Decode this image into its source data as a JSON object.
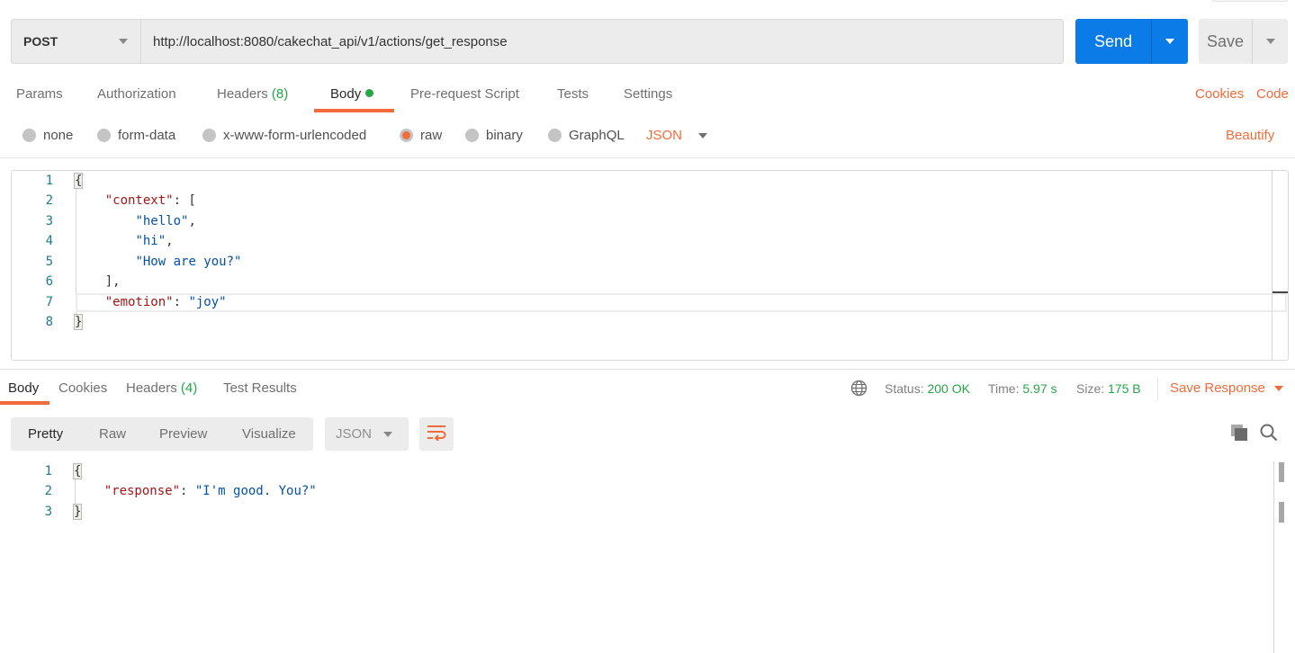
{
  "request": {
    "method": "POST",
    "url": "http://localhost:8080/cakechat_api/v1/actions/get_response",
    "send_label": "Send",
    "save_label": "Save"
  },
  "request_tabs": {
    "items": [
      {
        "label": "Params"
      },
      {
        "label": "Authorization"
      },
      {
        "label": "Headers",
        "count": "(8)"
      },
      {
        "label": "Body",
        "active": true,
        "indicator": "green-dot"
      },
      {
        "label": "Pre-request Script"
      },
      {
        "label": "Tests"
      },
      {
        "label": "Settings"
      }
    ],
    "cookies_link": "Cookies",
    "code_link": "Code"
  },
  "body_types": {
    "options": [
      "none",
      "form-data",
      "x-www-form-urlencoded",
      "raw",
      "binary",
      "GraphQL"
    ],
    "selected": "raw",
    "format": "JSON",
    "beautify_label": "Beautify"
  },
  "request_body": {
    "line_numbers": [
      "1",
      "2",
      "3",
      "4",
      "5",
      "6",
      "7",
      "8"
    ],
    "lines": [
      "{",
      "    \"context\": [",
      "        \"hello\",",
      "        \"hi\",",
      "        \"How are you?\"",
      "    ],",
      "    \"emotion\": \"joy\"",
      "}"
    ],
    "tokens": {
      "l1": "{",
      "l2_key": "\"context\"",
      "l2_rest": ": [",
      "l3": "\"hello\"",
      "l4": "\"hi\"",
      "l5": "\"How are you?\"",
      "l6": "],",
      "l7_key": "\"emotion\"",
      "l7_sep": ": ",
      "l7_val": "\"joy\"",
      "l8": "}",
      "comma": ","
    }
  },
  "response_tabs": {
    "items": [
      {
        "label": "Body",
        "active": true
      },
      {
        "label": "Cookies"
      },
      {
        "label": "Headers",
        "count": "(4)"
      },
      {
        "label": "Test Results"
      }
    ]
  },
  "response_meta": {
    "status_label": "Status:",
    "status_value": "200 OK",
    "time_label": "Time:",
    "time_value": "5.97 s",
    "size_label": "Size:",
    "size_value": "175 B",
    "save_response_label": "Save Response",
    "globe_icon": "globe-icon"
  },
  "response_view": {
    "modes": [
      "Pretty",
      "Raw",
      "Preview",
      "Visualize"
    ],
    "active_mode": "Pretty",
    "format": "JSON",
    "icons": [
      "wrap-lines-icon",
      "copy-icon",
      "search-icon"
    ]
  },
  "response_body": {
    "line_numbers": [
      "1",
      "2",
      "3"
    ],
    "tokens": {
      "l1": "{",
      "l2_key": "\"response\"",
      "l2_sep": ": ",
      "l2_val": "\"I'm good. You?\"",
      "l3": "}"
    }
  },
  "colors": {
    "accent_orange": "#f26b3a",
    "send_blue": "#0b7be8",
    "success_green": "#26a646"
  }
}
